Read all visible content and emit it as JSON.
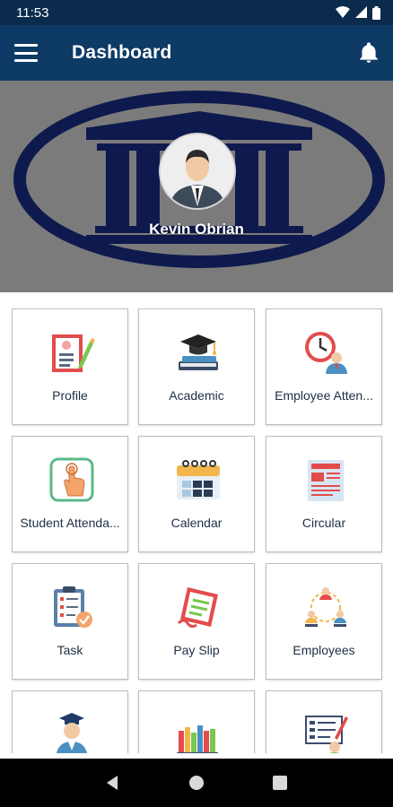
{
  "status_bar": {
    "time": "11:53"
  },
  "app_bar": {
    "title": "Dashboard"
  },
  "profile": {
    "name": "Kevin Obrian"
  },
  "tiles": [
    {
      "label": "Profile",
      "icon": "profile-icon"
    },
    {
      "label": "Academic",
      "icon": "academic-icon"
    },
    {
      "label": "Employee Atten...",
      "icon": "employee-attendance-icon"
    },
    {
      "label": "Student Attenda...",
      "icon": "student-attendance-icon"
    },
    {
      "label": "Calendar",
      "icon": "calendar-icon"
    },
    {
      "label": "Circular",
      "icon": "circular-icon"
    },
    {
      "label": "Task",
      "icon": "task-icon"
    },
    {
      "label": "Pay Slip",
      "icon": "pay-slip-icon"
    },
    {
      "label": "Employees",
      "icon": "employees-icon"
    },
    {
      "label": "",
      "icon": "student-icon"
    },
    {
      "label": "",
      "icon": "library-icon"
    },
    {
      "label": "",
      "icon": "exam-icon"
    }
  ],
  "colors": {
    "status_bar": "#0b2b4d",
    "app_bar": "#0e3a66",
    "banner": "#7b7b7b",
    "logo": "#0e1a4d"
  }
}
